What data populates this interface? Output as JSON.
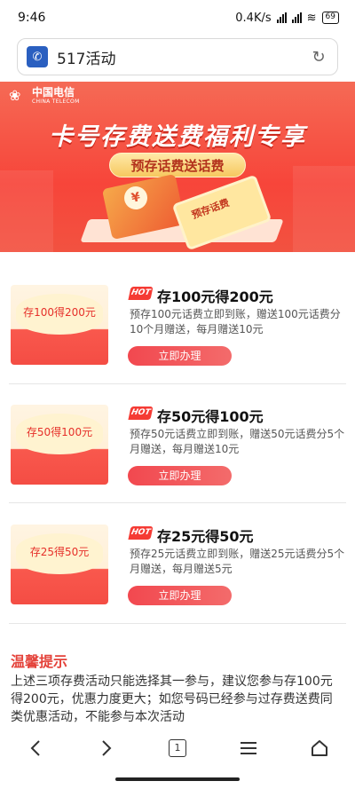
{
  "status": {
    "time": "9:46",
    "net_speed": "0.4K/s",
    "battery": "69"
  },
  "browser": {
    "url_text": "517活动",
    "tab_count": "1"
  },
  "banner": {
    "brand_cn": "中国电信",
    "brand_en": "CHINA TELECOM",
    "title": "卡号存费送费福利专享",
    "pill": "预存话费送话费",
    "card_text": "预存话费"
  },
  "offers": [
    {
      "image_text": "存100得200元",
      "hot": "HOT",
      "title": "存100元得200元",
      "desc": "预存100元话费立即到账，赠送100元话费分10个月赠送，每月赠送10元",
      "button": "立即办理"
    },
    {
      "image_text": "存50得100元",
      "hot": "HOT",
      "title": "存50元得100元",
      "desc": "预存50元话费立即到账，赠送50元话费分5个月赠送，每月赠送10元",
      "button": "立即办理"
    },
    {
      "image_text": "存25得50元",
      "hot": "HOT",
      "title": "存25元得50元",
      "desc": "预存25元话费立即到账，赠送25元话费分5个月赠送，每月赠送5元",
      "button": "立即办理"
    }
  ],
  "notes": {
    "title": "温馨提示",
    "text": "上述三项存费活动只能选择其一参与，建议您参与存100元得200元，优惠力度更大；如您号码已经参与过存费送费同类优惠活动，不能参与本次活动"
  }
}
